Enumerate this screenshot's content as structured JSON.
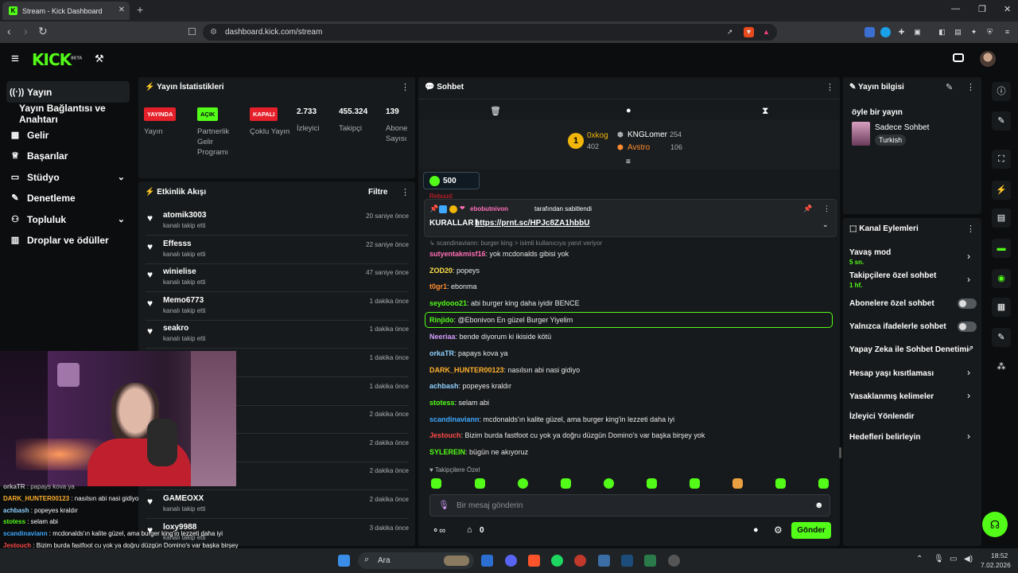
{
  "browser": {
    "tab_title": "Stream - Kick Dashboard",
    "url": "dashboard.kick.com/stream"
  },
  "app": {
    "logo": "KICK",
    "logo_beta": "BETA"
  },
  "sidebar": {
    "items": [
      {
        "label": "Yayın",
        "icon": "broadcast-icon"
      },
      {
        "label": "Yayın Bağlantısı ve Anahtarı",
        "icon": ""
      },
      {
        "label": "Gelir",
        "icon": "chart-icon"
      },
      {
        "label": "Başarılar",
        "icon": "trophy-icon"
      },
      {
        "label": "Stüdyo",
        "icon": "studio-icon"
      },
      {
        "label": "Denetleme",
        "icon": "wrench-icon"
      },
      {
        "label": "Topluluk",
        "icon": "users-icon"
      },
      {
        "label": "Droplar ve ödüller",
        "icon": "gift-icon"
      }
    ]
  },
  "stats": {
    "title": "Yayın İstatistikleri",
    "badges": [
      {
        "text": "YAYINDA",
        "color": "#e5202a",
        "label": "Yayın"
      },
      {
        "text": "AÇIK",
        "color": "#53fc18",
        "label": "Partnerlik Gelir Programı"
      },
      {
        "text": "KAPALI",
        "color": "#e5202a",
        "label": "Çoklu Yayın"
      }
    ],
    "numbers": [
      {
        "value": "2.733",
        "label": "İzleyici"
      },
      {
        "value": "455.324",
        "label": "Takipçi"
      },
      {
        "value": "139",
        "label": "Abone Sayısı"
      }
    ]
  },
  "events": {
    "title": "Etkinlik Akışı",
    "filter": "Filtre",
    "items": [
      {
        "name": "atomik3003",
        "action": "kanalı takip etti",
        "time": "20 saniye önce"
      },
      {
        "name": "Effesss",
        "action": "kanalı takip etti",
        "time": "22 saniye önce"
      },
      {
        "name": "winielise",
        "action": "kanalı takip etti",
        "time": "47 saniye önce"
      },
      {
        "name": "Memo6773",
        "action": "kanalı takip etti",
        "time": "1 dakika önce"
      },
      {
        "name": "seakro",
        "action": "kanalı takip etti",
        "time": "1 dakika önce"
      },
      {
        "name": "",
        "action": "",
        "time": "1 dakika önce"
      },
      {
        "name": "",
        "action": "",
        "time": "1 dakika önce"
      },
      {
        "name": "",
        "action": "",
        "time": "2 dakika önce"
      },
      {
        "name": "",
        "action": "",
        "time": "2 dakika önce"
      },
      {
        "name": "",
        "action": "",
        "time": "2 dakika önce"
      },
      {
        "name": "GAMEOXX",
        "action": "kanalı takip etti",
        "time": "2 dakika önce"
      },
      {
        "name": "loxy9988",
        "action": "kanalı takip etti",
        "time": "3 dakika önce"
      }
    ]
  },
  "overlay_chat": [
    {
      "user": "orkaTR",
      "msg": " : papays kova ya",
      "color": "#fff"
    },
    {
      "user": "DARK_HUNTER00123",
      "msg": " : nasılsın abi nasi gidiyo",
      "color": "#ffb02e"
    },
    {
      "user": "achbash",
      "msg": " : popeyes kraldır",
      "color": "#8fd1ff"
    },
    {
      "user": "stotess",
      "msg": " : selam abi",
      "color": "#53fc18"
    },
    {
      "user": "scandinaviann",
      "msg": " : mcdonalds'ın kalite güzel, ama burger king'in lezzeti daha iyi",
      "color": "#3fa9ff"
    },
    {
      "user": "Jestouch",
      "msg": " : Bizim burda fastfoot cu yok ya doğru düzgün Domino's var başka birşey yok",
      "color": "#ff4a4a"
    }
  ],
  "chat": {
    "title": "Sohbet",
    "leaderboard": [
      {
        "rank": "1",
        "name": "0xkog",
        "count": "402"
      },
      {
        "name": "KNGLomer",
        "count": "254"
      },
      {
        "name": "Avstro",
        "count": "106"
      }
    ],
    "goal_value": "500",
    "prev_user": "Rebuud:",
    "pinned": {
      "by": "ebobutnivon",
      "suffix": "tarafından sabitlendi",
      "prefix": "KURALLAR |",
      "link": "https://prnt.sc/HPJc8ZA1hbbU"
    },
    "reply_hint": "scandinaviann: burger king > isimli kullanıcıya yanıt veriyor",
    "messages": [
      {
        "user": "sutyentakmisf16",
        "text": ": yok mcdonalds gibisi yok",
        "color": "#ff6fb5"
      },
      {
        "user": "ZOD20",
        "text": ": popeys",
        "color": "#ffe14a"
      },
      {
        "user": "t0gr1",
        "text": ": ebonma",
        "color": "#ff8c2e"
      },
      {
        "user": "seydooo21",
        "text": ": abi burger king daha iyidir BENCE",
        "color": "#53fc18"
      },
      {
        "user": "Rinjido",
        "text": ": @Ebonivon En güzel Burger Yiyelim",
        "color": "#53fc18"
      },
      {
        "user": "Neeriaa",
        "text": ": bende diyorum ki ikiside kötü",
        "color": "#d59cff"
      },
      {
        "user": "orkaTR",
        "text": ": papays kova ya",
        "color": "#8fd1ff"
      },
      {
        "user": "DARK_HUNTER00123",
        "text": ": nasılsın abi nasi gidiyo",
        "color": "#ffb02e"
      },
      {
        "user": "achbash",
        "text": ": popeyes kraldır",
        "color": "#8fd1ff"
      },
      {
        "user": "stotess",
        "text": ": selam abi",
        "color": "#53fc18"
      },
      {
        "user": "scandinaviann",
        "text": ": mcdonalds'ın kalite güzel, ama burger king'in lezzeti daha iyi",
        "color": "#3fa9ff"
      },
      {
        "user": "Jestouch",
        "text": ": Bizim burda fastfoot cu yok ya doğru düzgün Domino's var başka birşey yok",
        "color": "#ff4a4a"
      },
      {
        "user": "SYLEREIN",
        "text": ": bügün ne akıyoruz",
        "color": "#53fc18"
      }
    ],
    "followers_only": "Takipçilere Özel",
    "input_placeholder": "Bir mesaj gönderin",
    "count": "0",
    "send": "Gönder"
  },
  "info": {
    "title": "Yayın bilgisi",
    "stream_title": "öyle bir yayın",
    "category": "Sadece Sohbet",
    "language": "Turkish"
  },
  "actions": {
    "title": "Kanal Eylemleri",
    "items": [
      {
        "label": "Yavaş mod",
        "sub": "5 sn.",
        "type": "arrow"
      },
      {
        "label": "Takipçilere özel sohbet",
        "sub": "1 hf.",
        "type": "arrow"
      },
      {
        "label": "Abonelere özel sohbet",
        "sub": "",
        "type": "toggle"
      },
      {
        "label": "Yalnızca ifadelerle sohbet",
        "sub": "",
        "type": "toggle"
      },
      {
        "label": "Yapay Zeka ile Sohbet Denetimi",
        "sub": "",
        "type": "external"
      },
      {
        "label": "Hesap yaşı kısıtlaması",
        "sub": "",
        "type": "arrow"
      },
      {
        "label": "Yasaklanmış kelimeler",
        "sub": "",
        "type": "arrow"
      },
      {
        "label": "İzleyici Yönlendir",
        "sub": "",
        "type": "none"
      },
      {
        "label": "Hedefleri belirleyin",
        "sub": "",
        "type": "arrow"
      }
    ]
  },
  "taskbar": {
    "search": "Ara",
    "time": "18:52",
    "date": "7.02.2026"
  },
  "colors": {
    "accent": "#53fc18",
    "panel": "#171a1c",
    "bg": "#0b0d0e",
    "live": "#e5202a"
  }
}
